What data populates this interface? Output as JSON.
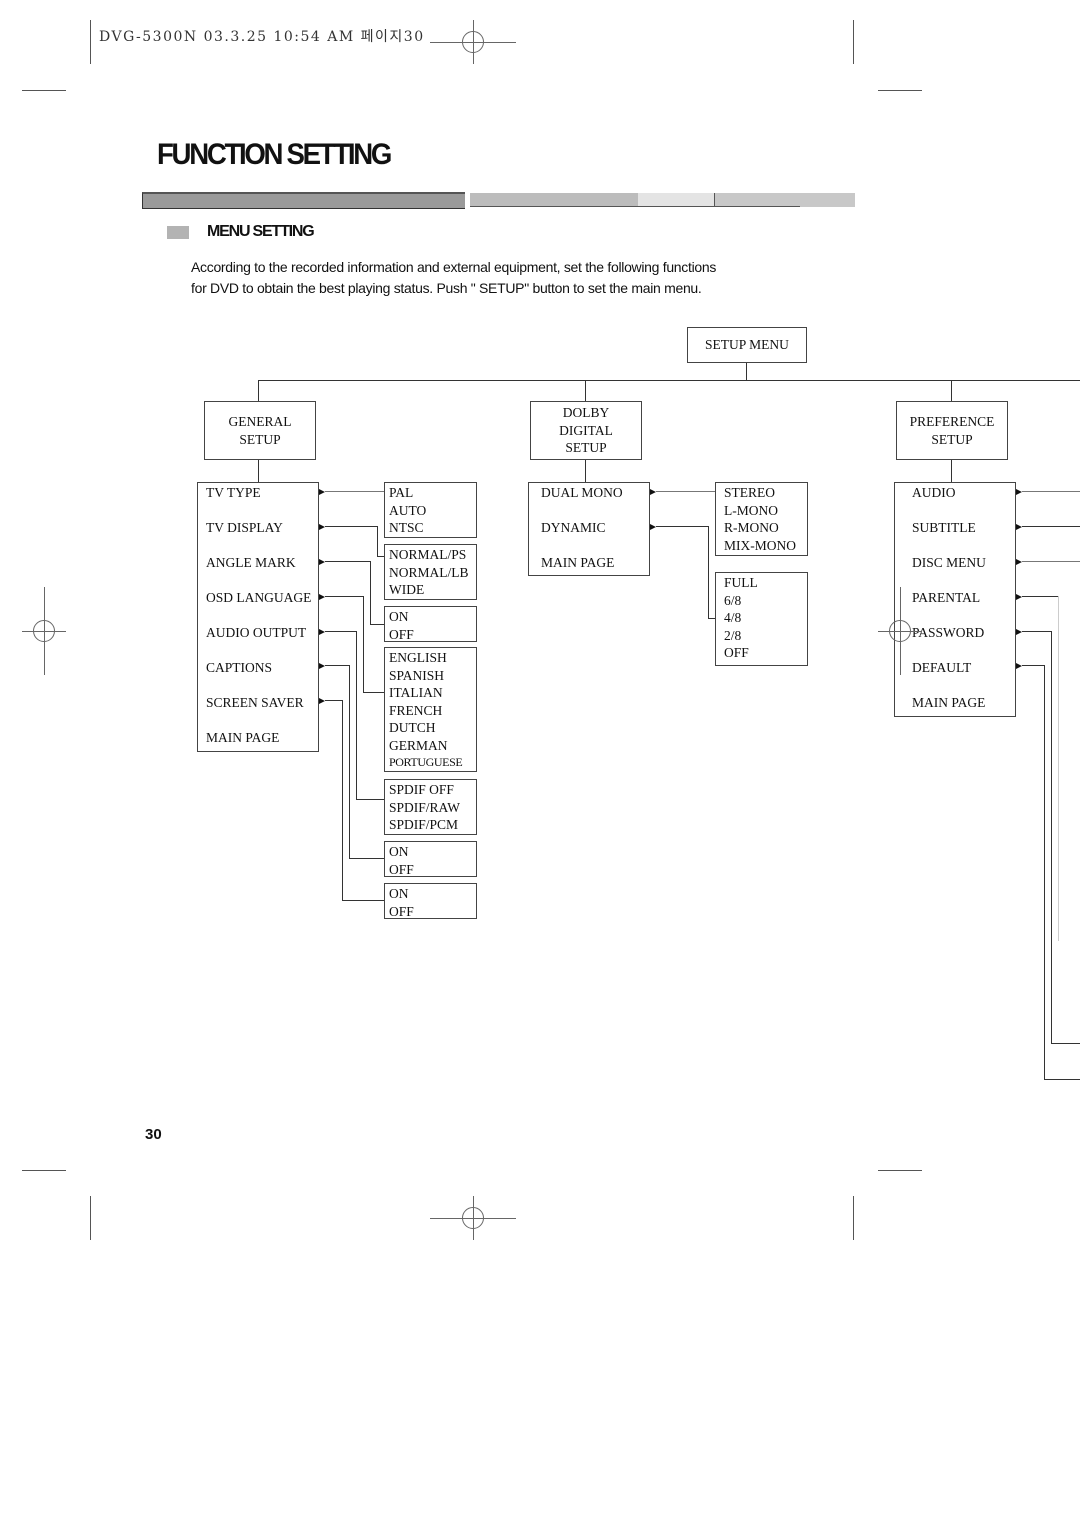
{
  "print_header": {
    "text": "DVG-5300N  03.3.25 10:54 AM 페이지30"
  },
  "page": {
    "title": "FUNCTION SETTING",
    "section_title": "MENU SETTING",
    "intro_line1": "According to the recorded information and external equipment, set the following functions",
    "intro_line2": "for DVD to obtain the best playing status. Push \" SETUP\"  button to set the main menu.",
    "page_number": "30"
  },
  "diagram": {
    "root": "SETUP MENU",
    "general_setup": {
      "title_line1": "GENERAL",
      "title_line2": "SETUP",
      "items": [
        "TV TYPE",
        "TV DISPLAY",
        "ANGLE MARK",
        "OSD LANGUAGE",
        "AUDIO OUTPUT",
        "CAPTIONS",
        "SCREEN SAVER",
        "MAIN PAGE"
      ],
      "options": {
        "tv_type": [
          "PAL",
          "AUTO",
          "NTSC"
        ],
        "tv_display": [
          "NORMAL/PS",
          "NORMAL/LB",
          "WIDE"
        ],
        "angle_mark": [
          "ON",
          "OFF"
        ],
        "osd_language": [
          "ENGLISH",
          "SPANISH",
          "ITALIAN",
          "FRENCH",
          "DUTCH",
          "GERMAN",
          "PORTUGUESE"
        ],
        "audio_output": [
          "SPDIF OFF",
          "SPDIF/RAW",
          "SPDIF/PCM"
        ],
        "captions": [
          "ON",
          "OFF"
        ],
        "screen_saver": [
          "ON",
          "OFF"
        ]
      }
    },
    "dolby_setup": {
      "title_line1": "DOLBY",
      "title_line2": "DIGITAL",
      "title_line3": "SETUP",
      "items": [
        "DUAL MONO",
        "DYNAMIC",
        "MAIN PAGE"
      ],
      "options": {
        "dual_mono": [
          "STEREO",
          "L-MONO",
          "R-MONO",
          "MIX-MONO"
        ],
        "dynamic": [
          "FULL",
          "6/8",
          "4/8",
          "2/8",
          "OFF"
        ]
      }
    },
    "preference_setup": {
      "title_line1": "PREFERENCE",
      "title_line2": "SETUP",
      "items": [
        "AUDIO",
        "SUBTITLE",
        "DISC MENU",
        "PARENTAL",
        "PASSWORD",
        "DEFAULT",
        "MAIN PAGE"
      ]
    }
  }
}
